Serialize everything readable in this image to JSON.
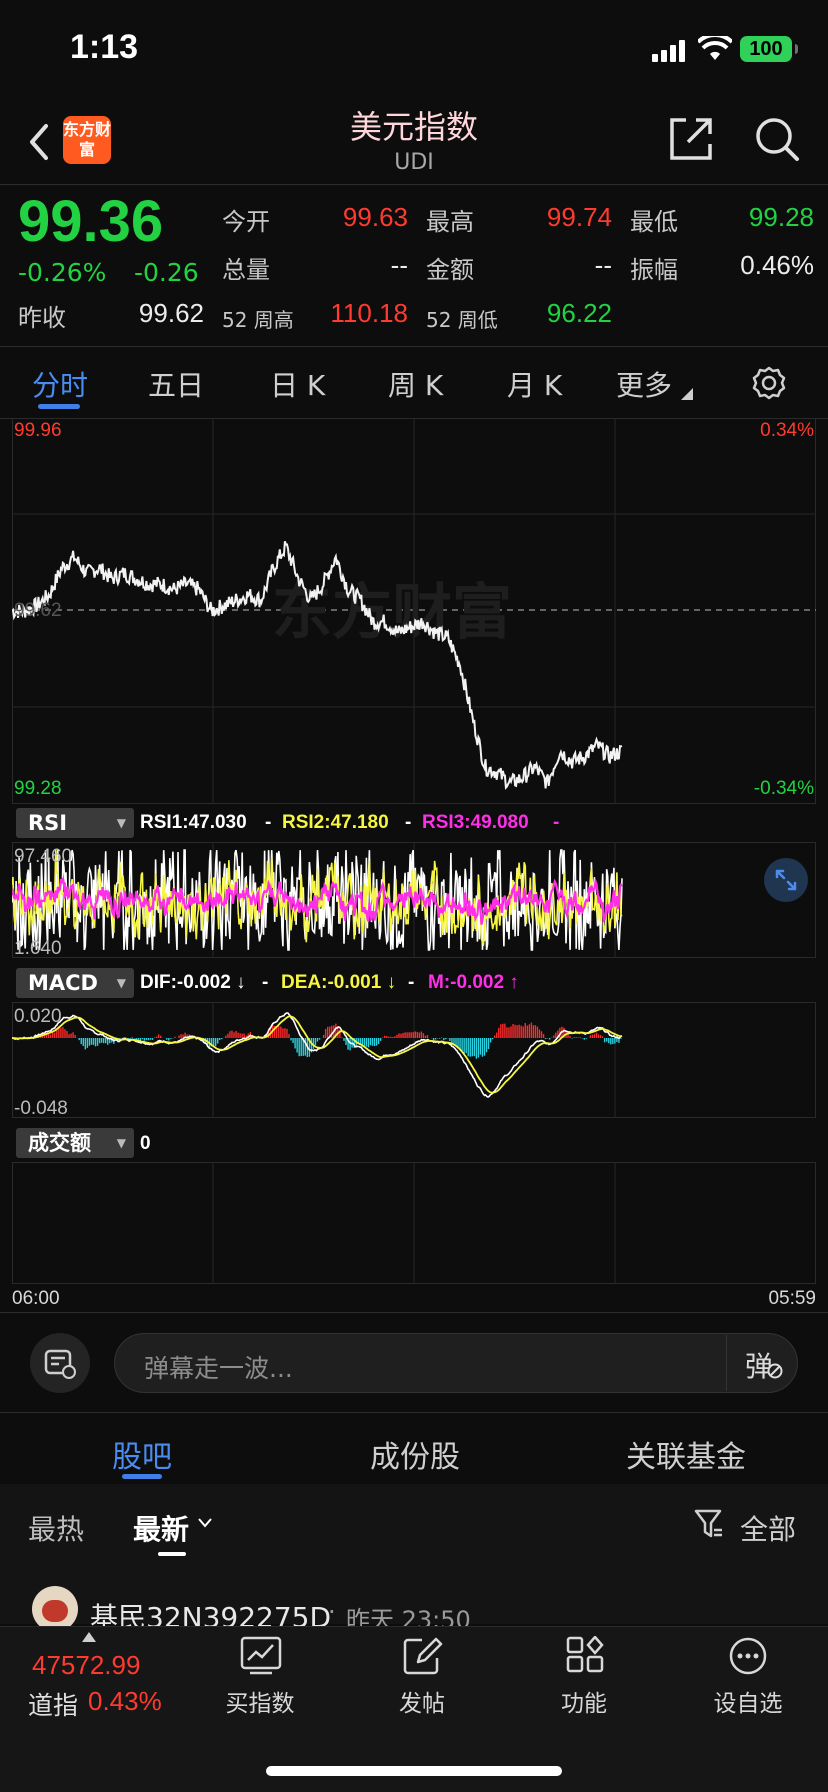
{
  "status_bar": {
    "time": "1:13",
    "battery": "100"
  },
  "header": {
    "title": "美元指数",
    "subtitle": "UDI",
    "logo_text": "东方财富"
  },
  "quote": {
    "price": "99.36",
    "change_pct": "-0.26%",
    "change": "-0.26",
    "prev_close_label": "昨收",
    "prev_close": "99.62",
    "fields": {
      "open_label": "今开",
      "open": "99.63",
      "high_label": "最高",
      "high": "99.74",
      "low_label": "最低",
      "low": "99.28",
      "volume_label": "总量",
      "volume": "--",
      "amount_label": "金额",
      "amount": "--",
      "amplitude_label": "振幅",
      "amplitude": "0.46%",
      "wk52_high_label": "52 周高",
      "wk52_high": "110.18",
      "wk52_low_label": "52 周低",
      "wk52_low": "96.22"
    }
  },
  "tabs": [
    "分时",
    "五日",
    "日 K",
    "周 K",
    "月 K",
    "更多"
  ],
  "chart": {
    "price_top": "99.96",
    "price_top_pct": "0.34%",
    "price_bottom": "99.28",
    "price_bottom_pct": "-0.34%",
    "price_mid": "99.62",
    "watermark": "东方财富",
    "time_start": "06:00",
    "time_end": "05:59",
    "rsi": {
      "name": "RSI",
      "rsi1": "RSI1:47.030",
      "rsi2": "RSI2:47.180",
      "rsi3": "RSI3:49.080",
      "sep": "-",
      "top": "97.460",
      "bottom": "1.640"
    },
    "macd": {
      "name": "MACD",
      "dif": "DIF:-0.002 ↓",
      "dea": "DEA:-0.001 ↓",
      "m": "M:-0.002 ↑",
      "sep": "-",
      "top": "0.020",
      "bottom": "-0.048"
    },
    "volume": {
      "name": "成交额",
      "value": "0"
    },
    "colors": {
      "up": "#ff3b30",
      "down": "#23d243",
      "rsi2": "#f5f542",
      "rsi3": "#ff2fe8",
      "macd_pos": "#ff2b2b",
      "macd_neg": "#29d2e0"
    }
  },
  "chart_data": {
    "type": "line",
    "title": "",
    "xlabel": "",
    "ylabel": "",
    "x_range": [
      "06:00",
      "05:59"
    ],
    "ylim": [
      99.28,
      99.96
    ],
    "reference": 99.62,
    "series": [
      {
        "values": [
          99.62,
          99.62,
          99.63,
          99.65,
          99.7,
          99.72,
          99.69,
          99.7,
          99.68,
          99.69,
          99.68,
          99.67,
          99.67,
          99.66,
          99.67,
          99.66,
          99.62,
          99.63,
          99.64,
          99.65,
          99.64,
          99.7,
          99.74,
          99.68,
          99.64,
          99.67,
          99.72,
          99.66,
          99.64,
          99.6,
          99.6,
          99.58,
          99.59,
          99.6,
          99.58,
          99.57,
          99.52,
          99.42,
          99.33,
          99.32,
          99.3,
          99.31,
          99.33,
          99.3,
          99.36,
          99.34,
          99.35,
          99.37,
          99.35,
          99.36
        ]
      }
    ]
  },
  "danmu": {
    "placeholder": "弹幕走一波...",
    "button": "弹"
  },
  "section_tabs": [
    "股吧",
    "成份股",
    "关联基金"
  ],
  "filters": {
    "hot": "最热",
    "latest": "最新",
    "all": "全部"
  },
  "post": {
    "user": "基民32N392275D",
    "dot": "·",
    "time": "昨天 23:50"
  },
  "bottom_nav": {
    "ticker_value": "47572.99",
    "ticker_name": "道指",
    "ticker_pct": "0.43%",
    "items": [
      "买指数",
      "发帖",
      "功能",
      "设自选"
    ]
  }
}
